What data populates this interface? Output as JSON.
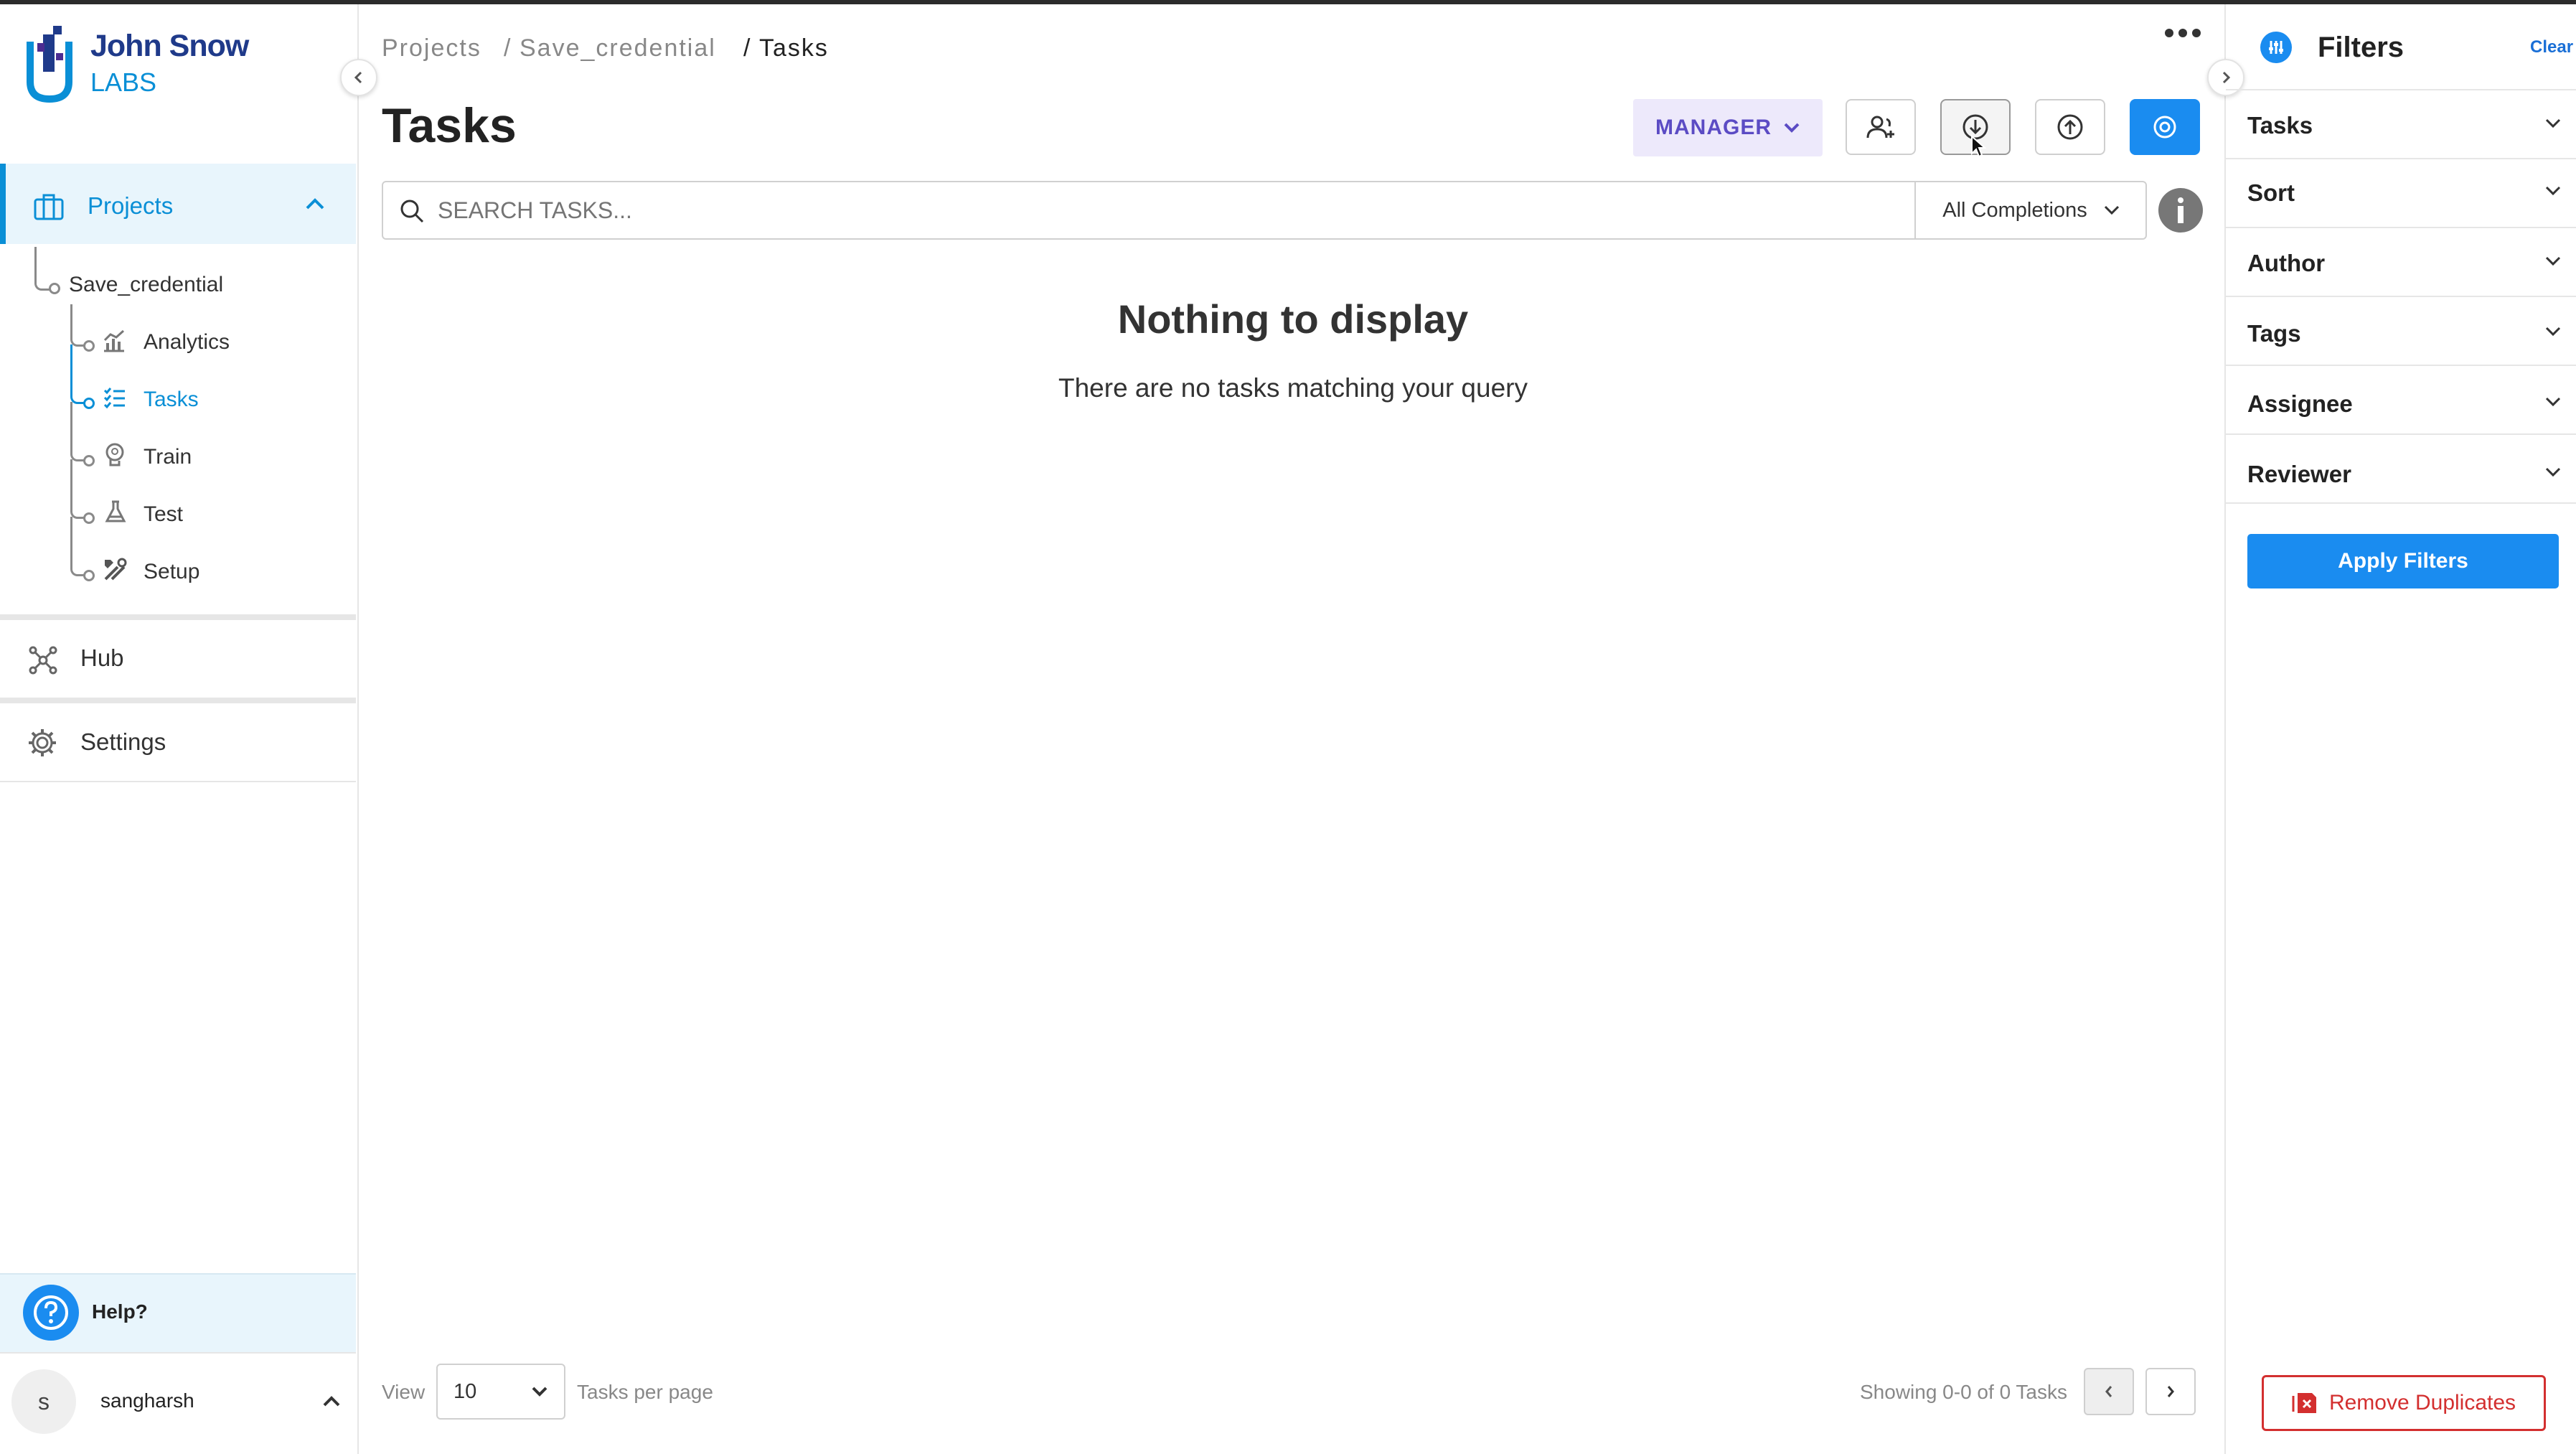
{
  "brand": {
    "name_line1": "John Snow",
    "name_line2": "LABS"
  },
  "sidebar": {
    "projects_label": "Projects",
    "project_name": "Save_credential",
    "sub_items": [
      {
        "label": "Analytics",
        "icon": "analytics-icon"
      },
      {
        "label": "Tasks",
        "icon": "tasks-list-icon",
        "active": true
      },
      {
        "label": "Train",
        "icon": "brain-icon"
      },
      {
        "label": "Test",
        "icon": "flask-icon"
      },
      {
        "label": "Setup",
        "icon": "tools-icon"
      }
    ],
    "hub_label": "Hub",
    "settings_label": "Settings",
    "help_label": "Help?",
    "user_initial": "s",
    "user_name": "sangharsh"
  },
  "breadcrumb": {
    "part1": "Projects",
    "sep1": "/",
    "part2": "Save_credential",
    "sep2": "/",
    "current": "Tasks"
  },
  "header": {
    "title": "Tasks",
    "role_label": "MANAGER"
  },
  "search": {
    "placeholder": "SEARCH TASKS...",
    "completions_filter": "All Completions"
  },
  "empty_state": {
    "title": "Nothing to display",
    "message": "There are no tasks matching your query"
  },
  "pagination": {
    "view_label": "View",
    "per_page_value": "10",
    "per_page_label": "Tasks per page",
    "showing": "Showing 0-0 of 0 Tasks"
  },
  "filters": {
    "title": "Filters",
    "clear_label": "Clear",
    "sections": [
      "Tasks",
      "Sort",
      "Author",
      "Tags",
      "Assignee",
      "Reviewer"
    ],
    "apply_label": "Apply Filters",
    "remove_duplicates_label": "Remove Duplicates"
  },
  "colors": {
    "accent": "#0a8fd6",
    "brand_dark": "#1f3a8a",
    "manager_bg": "#ede9fb",
    "manager_text": "#5b4bc4",
    "danger": "#d32f2f",
    "primary_button": "#1a8cf0"
  }
}
